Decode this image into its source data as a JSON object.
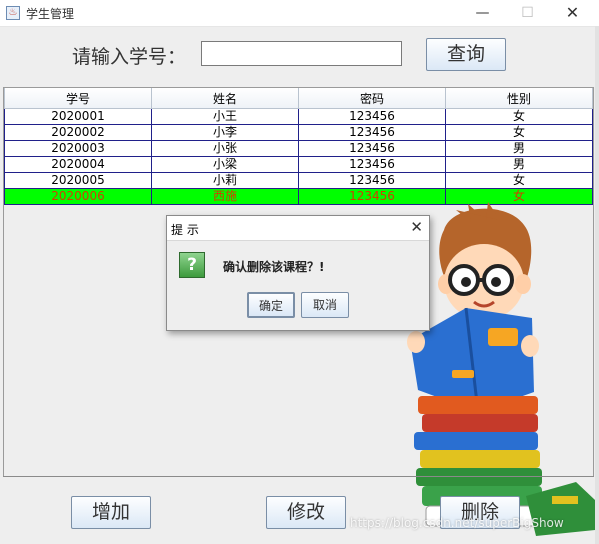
{
  "window": {
    "title": "学生管理",
    "minimize_label": "—",
    "maximize_label": "☐",
    "close_label": "✕"
  },
  "search": {
    "label": "请输入学号：",
    "value": "",
    "placeholder": "",
    "button_label": "查询"
  },
  "table": {
    "headers": [
      "学号",
      "姓名",
      "密码",
      "性别"
    ],
    "rows": [
      [
        "2020001",
        "小王",
        "123456",
        "女"
      ],
      [
        "2020002",
        "小李",
        "123456",
        "女"
      ],
      [
        "2020003",
        "小张",
        "123456",
        "男"
      ],
      [
        "2020004",
        "小梁",
        "123456",
        "男"
      ],
      [
        "2020005",
        "小莉",
        "123456",
        "女"
      ],
      [
        "2020006",
        "西施",
        "123456",
        "女"
      ]
    ],
    "selected_row_index": 5,
    "selected_row_background": "#00ff00",
    "selected_row_text_color": "#d04000"
  },
  "actions": {
    "add_label": "增加",
    "edit_label": "修改",
    "delete_label": "删除"
  },
  "dialog": {
    "title": "提 示",
    "close_label": "✕",
    "icon": "question-icon",
    "icon_glyph": "?",
    "message": "确认删除该课程？!",
    "ok_label": "确定",
    "cancel_label": "取消"
  },
  "watermark": "https://blog.csdn.net/superBigShow",
  "colors": {
    "accent_button": "#dbe8f6",
    "selection": "#00ff00",
    "grid_line": "#20208a"
  }
}
